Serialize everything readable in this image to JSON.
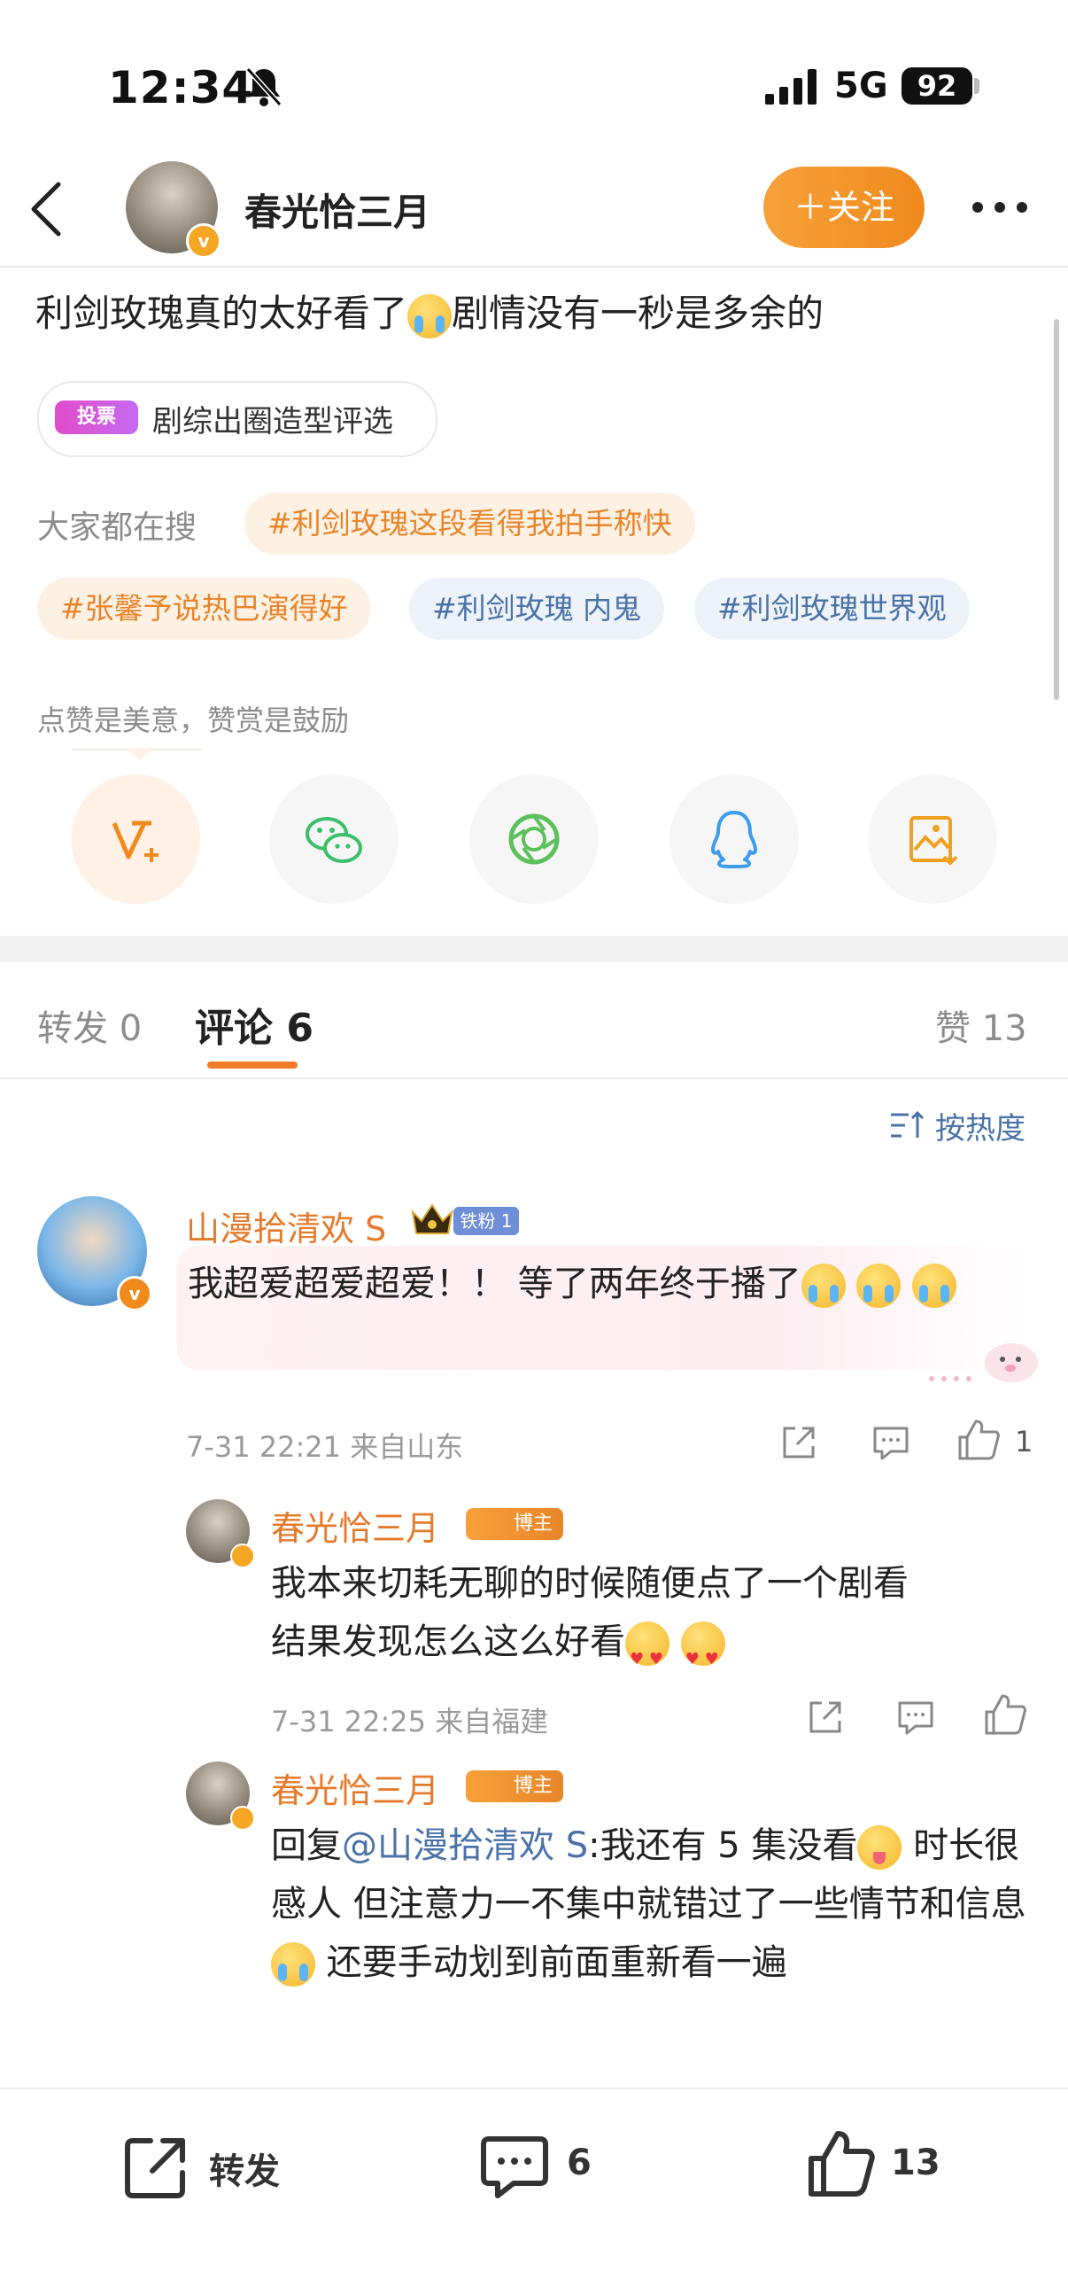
{
  "status_bar": {
    "time": "12:34",
    "network": "5G",
    "battery": "92"
  },
  "header": {
    "username": "春光恰三月",
    "follow_label": "＋关注"
  },
  "post": {
    "text_before": "利剑玫瑰真的太好看了",
    "text_after": "剧情没有一秒是多余的",
    "vote": {
      "badge": "投票",
      "label": "剧综出圈造型评选"
    },
    "search_label": "大家都在搜",
    "tags": [
      "#利剑玫瑰这段看得我拍手称快",
      "#张馨予说热巴演得好",
      "#利剑玫瑰 内鬼",
      "#利剑玫瑰世界观"
    ],
    "like_note": "点赞是美意，赞赏是鼓励"
  },
  "share_icons": [
    "v-plus-icon",
    "wechat-icon",
    "moments-icon",
    "qq-icon",
    "save-image-icon"
  ],
  "tabs": {
    "repost": "转发 0",
    "comments": "评论 6",
    "likes": "赞 13"
  },
  "sort_label": "按热度",
  "comments": [
    {
      "name": "山漫拾清欢 S",
      "fan_badge": "铁粉 1",
      "text": "我超爱超爱超爱！！ 等了两年终于播了",
      "meta": "7-31 22:21 来自山东",
      "likes": "1"
    }
  ],
  "replies": [
    {
      "name": "春光恰三月",
      "badge": "博主",
      "text_line1": "我本来切耗无聊的时候随便点了一个剧看",
      "text_line2": "结果发现怎么这么好看",
      "meta": "7-31 22:25 来自福建"
    },
    {
      "name": "春光恰三月",
      "badge": "博主",
      "prefix": "回复",
      "mention": "@山漫拾清欢 S",
      "part1": ":我还有 5 集没看",
      "part2": " 时长很感人 但注意力一不集中就错过了一些情节和信息",
      "part3": " 还要手动划到前面重新看一遍"
    }
  ],
  "bottom_bar": {
    "repost": "转发",
    "comment_count": "6",
    "like_count": "13"
  },
  "colors": {
    "accent": "#f08a1c",
    "name": "#e67a2b",
    "link": "#4a72a8"
  }
}
